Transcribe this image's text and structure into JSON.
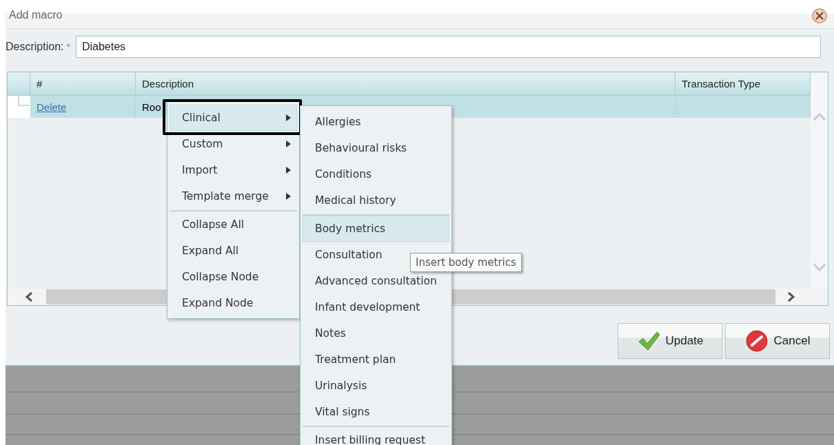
{
  "dialog": {
    "title": "Add macro",
    "description": {
      "label": "Description:",
      "required_mark": "*",
      "value": "Diabetes"
    },
    "grid": {
      "columns": [
        {
          "label": "#"
        },
        {
          "label": "Description"
        },
        {
          "label": "Transaction Type"
        }
      ],
      "rows": [
        {
          "selected": true,
          "link": "Delete",
          "description": "Roo"
        }
      ]
    },
    "buttons": [
      {
        "label": "Update",
        "kind": "confirm"
      },
      {
        "label": "Cancel",
        "kind": "cancel"
      }
    ]
  },
  "context_menu": {
    "groups": [
      {
        "items": [
          {
            "label": "Clinical",
            "has_submenu": true,
            "selected": true,
            "outlined": true
          },
          {
            "label": "Custom",
            "has_submenu": true,
            "selected": false,
            "outlined": false
          },
          {
            "label": "Import",
            "has_submenu": true,
            "selected": false,
            "outlined": false
          },
          {
            "label": "Template merge",
            "has_submenu": true,
            "selected": false,
            "outlined": false
          }
        ]
      },
      {
        "items": [
          {
            "label": "Collapse All",
            "has_submenu": false,
            "selected": false,
            "outlined": false
          },
          {
            "label": "Expand All",
            "has_submenu": false,
            "selected": false,
            "outlined": false
          },
          {
            "label": "Collapse Node",
            "has_submenu": false,
            "selected": false,
            "outlined": false
          },
          {
            "label": "Expand Node",
            "has_submenu": false,
            "selected": false,
            "outlined": false
          }
        ]
      }
    ]
  },
  "submenu": {
    "groups": [
      {
        "items": [
          {
            "label": "Allergies",
            "has_submenu": false,
            "selected": false,
            "outlined": false
          },
          {
            "label": "Behavioural risks",
            "has_submenu": false,
            "selected": false,
            "outlined": false
          },
          {
            "label": "Conditions",
            "has_submenu": false,
            "selected": false,
            "outlined": false
          },
          {
            "label": "Medical history",
            "has_submenu": false,
            "selected": false,
            "outlined": false
          }
        ]
      },
      {
        "items": [
          {
            "label": "Body metrics",
            "has_submenu": false,
            "selected": true,
            "outlined": false
          },
          {
            "label": "Consultation",
            "has_submenu": false,
            "selected": false,
            "outlined": false
          },
          {
            "label": "Advanced consultation",
            "has_submenu": false,
            "selected": false,
            "outlined": false
          },
          {
            "label": "Infant development",
            "has_submenu": false,
            "selected": false,
            "outlined": false
          },
          {
            "label": "Notes",
            "has_submenu": false,
            "selected": false,
            "outlined": false
          },
          {
            "label": "Treatment plan",
            "has_submenu": false,
            "selected": false,
            "outlined": false
          },
          {
            "label": "Urinalysis",
            "has_submenu": false,
            "selected": false,
            "outlined": false
          },
          {
            "label": "Vital signs",
            "has_submenu": false,
            "selected": false,
            "outlined": false
          }
        ]
      },
      {
        "items": [
          {
            "label": "Insert billing request",
            "has_submenu": false,
            "selected": false,
            "outlined": false
          }
        ]
      }
    ]
  },
  "tooltip": {
    "text": "Insert body metrics"
  }
}
